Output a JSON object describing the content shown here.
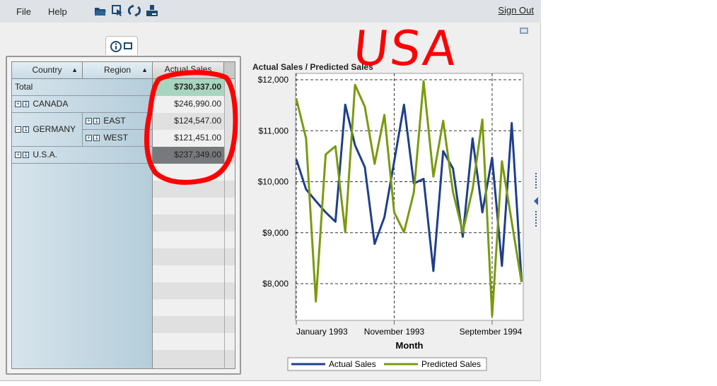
{
  "menu": {
    "file": "File",
    "help": "Help",
    "sign_out": "Sign Out"
  },
  "toolbar_icons": [
    "open-folder-icon",
    "select-icon",
    "refresh-icon",
    "export-icon"
  ],
  "table": {
    "headers": {
      "country": "Country",
      "region": "Region",
      "actual_sales": "Actual Sales"
    },
    "sort_glyph": "▲",
    "rows": {
      "total": {
        "label": "Total",
        "value": "$730,337.00"
      },
      "canada": {
        "label": "CANADA",
        "value": "$246,990.00"
      },
      "germany": {
        "label": "GERMANY"
      },
      "east": {
        "label": "EAST",
        "value": "$124,547.00"
      },
      "west": {
        "label": "WEST",
        "value": "$121,451.00"
      },
      "usa": {
        "label": "U.S.A.",
        "value": "$237,349.00"
      }
    }
  },
  "annotation": {
    "text": "USA",
    "color": "#ff0000"
  },
  "colors": {
    "actual": "#1f3f8a",
    "predicted": "#7a9a0f",
    "total_bg": "#a8d5bf",
    "usa_bg": "#77797c"
  },
  "chart_data": {
    "type": "line",
    "title": "Actual Sales / Predicted Sales",
    "xlabel": "Month",
    "ylabel": "",
    "x": [
      "Jan 1993",
      "Feb 1993",
      "Mar 1993",
      "Apr 1993",
      "May 1993",
      "Jun 1993",
      "Jul 1993",
      "Aug 1993",
      "Sep 1993",
      "Oct 1993",
      "Nov 1993",
      "Dec 1993",
      "Jan 1994",
      "Feb 1994",
      "Mar 1994",
      "Apr 1994",
      "May 1994",
      "Jun 1994",
      "Jul 1994",
      "Aug 1994",
      "Sep 1994",
      "Oct 1994",
      "Nov 1994",
      "Dec 1994"
    ],
    "x_ticks": [
      "January 1993",
      "November 1993",
      "September 1994"
    ],
    "y_ticks": [
      "$8,000",
      "$9,000",
      "$10,000",
      "$11,000",
      "$12,000"
    ],
    "y_tick_values": [
      8000,
      9000,
      10000,
      11000,
      12000
    ],
    "ylim": [
      7300,
      12060
    ],
    "grid": true,
    "legend_position": "bottom",
    "series": [
      {
        "name": "Actual Sales",
        "values": [
          10440,
          9850,
          9620,
          9400,
          9215,
          11510,
          10715,
          10285,
          8780,
          9305,
          10400,
          11510,
          9965,
          10055,
          8250,
          10600,
          10260,
          8920,
          10850,
          9400,
          10470,
          8350,
          11150,
          8050
        ]
      },
      {
        "name": "Predicted Sales",
        "values": [
          11630,
          10850,
          7650,
          10535,
          10695,
          9010,
          11900,
          11470,
          10350,
          11310,
          9400,
          9010,
          9785,
          11970,
          10100,
          11195,
          9800,
          9010,
          9850,
          11220,
          7370,
          10400,
          9215,
          8030
        ]
      }
    ]
  }
}
